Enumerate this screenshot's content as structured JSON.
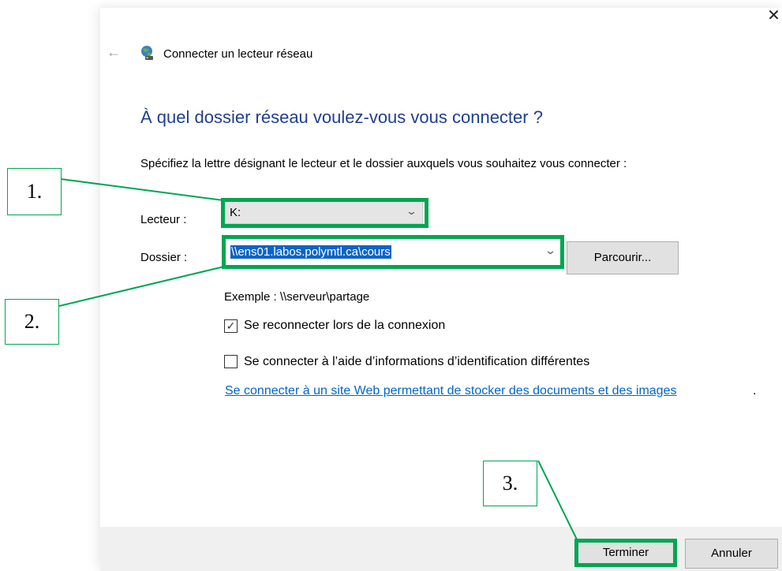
{
  "window": {
    "title": "Connecter un lecteur réseau",
    "close_glyph": "✕",
    "back_glyph": "←",
    "icon": "network-drive-icon"
  },
  "main": {
    "heading": "À quel dossier réseau voulez-vous vous connecter ?",
    "instruction": "Spécifiez la lettre désignant le lecteur et le dossier auxquels vous souhaitez vous connecter :",
    "drive_label": "Lecteur :",
    "drive_value": "K:",
    "folder_label": "Dossier :",
    "folder_value": "\\\\ens01.labos.polymtl.ca\\cours",
    "browse_label": "Parcourir...",
    "example": "Exemple : \\\\serveur\\partage",
    "reconnect_label": "Se reconnecter lors de la connexion",
    "reconnect_checked": true,
    "other_credentials_label": "Se connecter à l’aide d’informations d’identification différentes",
    "other_credentials_checked": false,
    "web_link": "Se connecter à un site Web permettant de stocker des documents et des images",
    "web_link_suffix": "."
  },
  "footer": {
    "finish_label": "Terminer",
    "cancel_label": "Annuler"
  },
  "annotations": {
    "callout_1": "1.",
    "callout_2": "2.",
    "callout_3": "3.",
    "color": "#00a651"
  },
  "colors": {
    "heading": "#1f3f8f",
    "link": "#0066cc",
    "selection": "#0a64c8",
    "footer_bg": "#f0f0f0"
  }
}
